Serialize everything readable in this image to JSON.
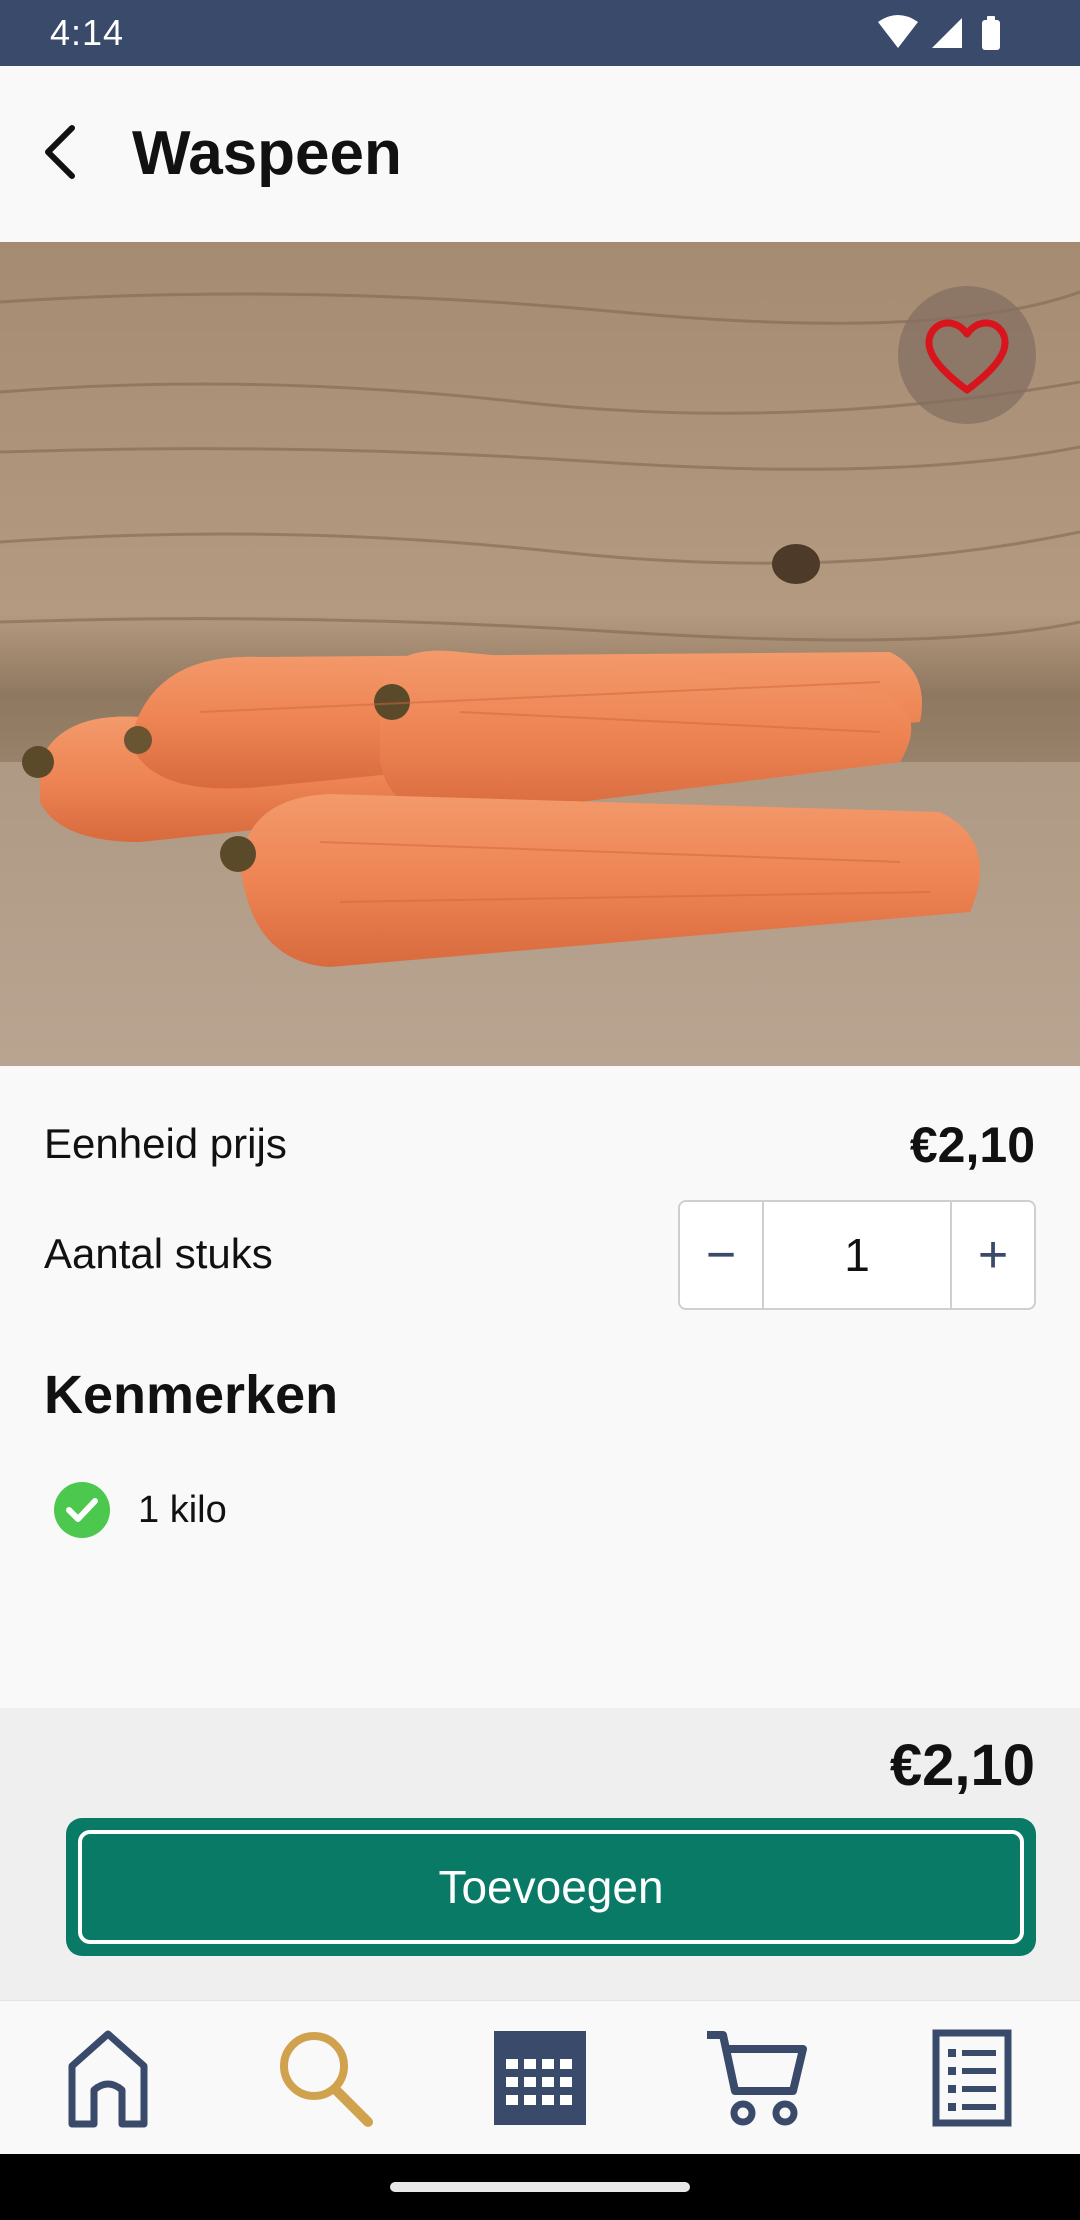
{
  "status_bar": {
    "time": "4:14",
    "icons": [
      "wifi-icon",
      "signal-icon",
      "battery-icon"
    ]
  },
  "header": {
    "back_icon": "arrow-left-icon",
    "title": "Waspeen"
  },
  "product": {
    "image_description_icon": "carrot-photo",
    "favorite_icon": "heart-outline-icon",
    "favorite_color": "#d8141c"
  },
  "details": {
    "unit_price_label": "Eenheid prijs",
    "unit_price_value": "€2,10",
    "quantity_label": "Aantal stuks",
    "quantity_value": "1",
    "minus_symbol": "−",
    "plus_symbol": "+"
  },
  "features": {
    "title": "Kenmerken",
    "items": [
      {
        "label": "1 kilo",
        "icon": "check-circle-icon"
      }
    ]
  },
  "footer": {
    "total_price": "€2,10",
    "add_button_label": "Toevoegen"
  },
  "bottom_nav": {
    "items": [
      {
        "icon": "home-icon",
        "active": false
      },
      {
        "icon": "search-icon",
        "active": true
      },
      {
        "icon": "calendar-icon",
        "active": false
      },
      {
        "icon": "cart-icon",
        "active": false
      },
      {
        "icon": "list-icon",
        "active": false
      }
    ]
  },
  "colors": {
    "primary": "#087a66",
    "nav_blue": "#3a4a6b",
    "nav_active": "#d0a24e",
    "check_green": "#4cc84e"
  }
}
